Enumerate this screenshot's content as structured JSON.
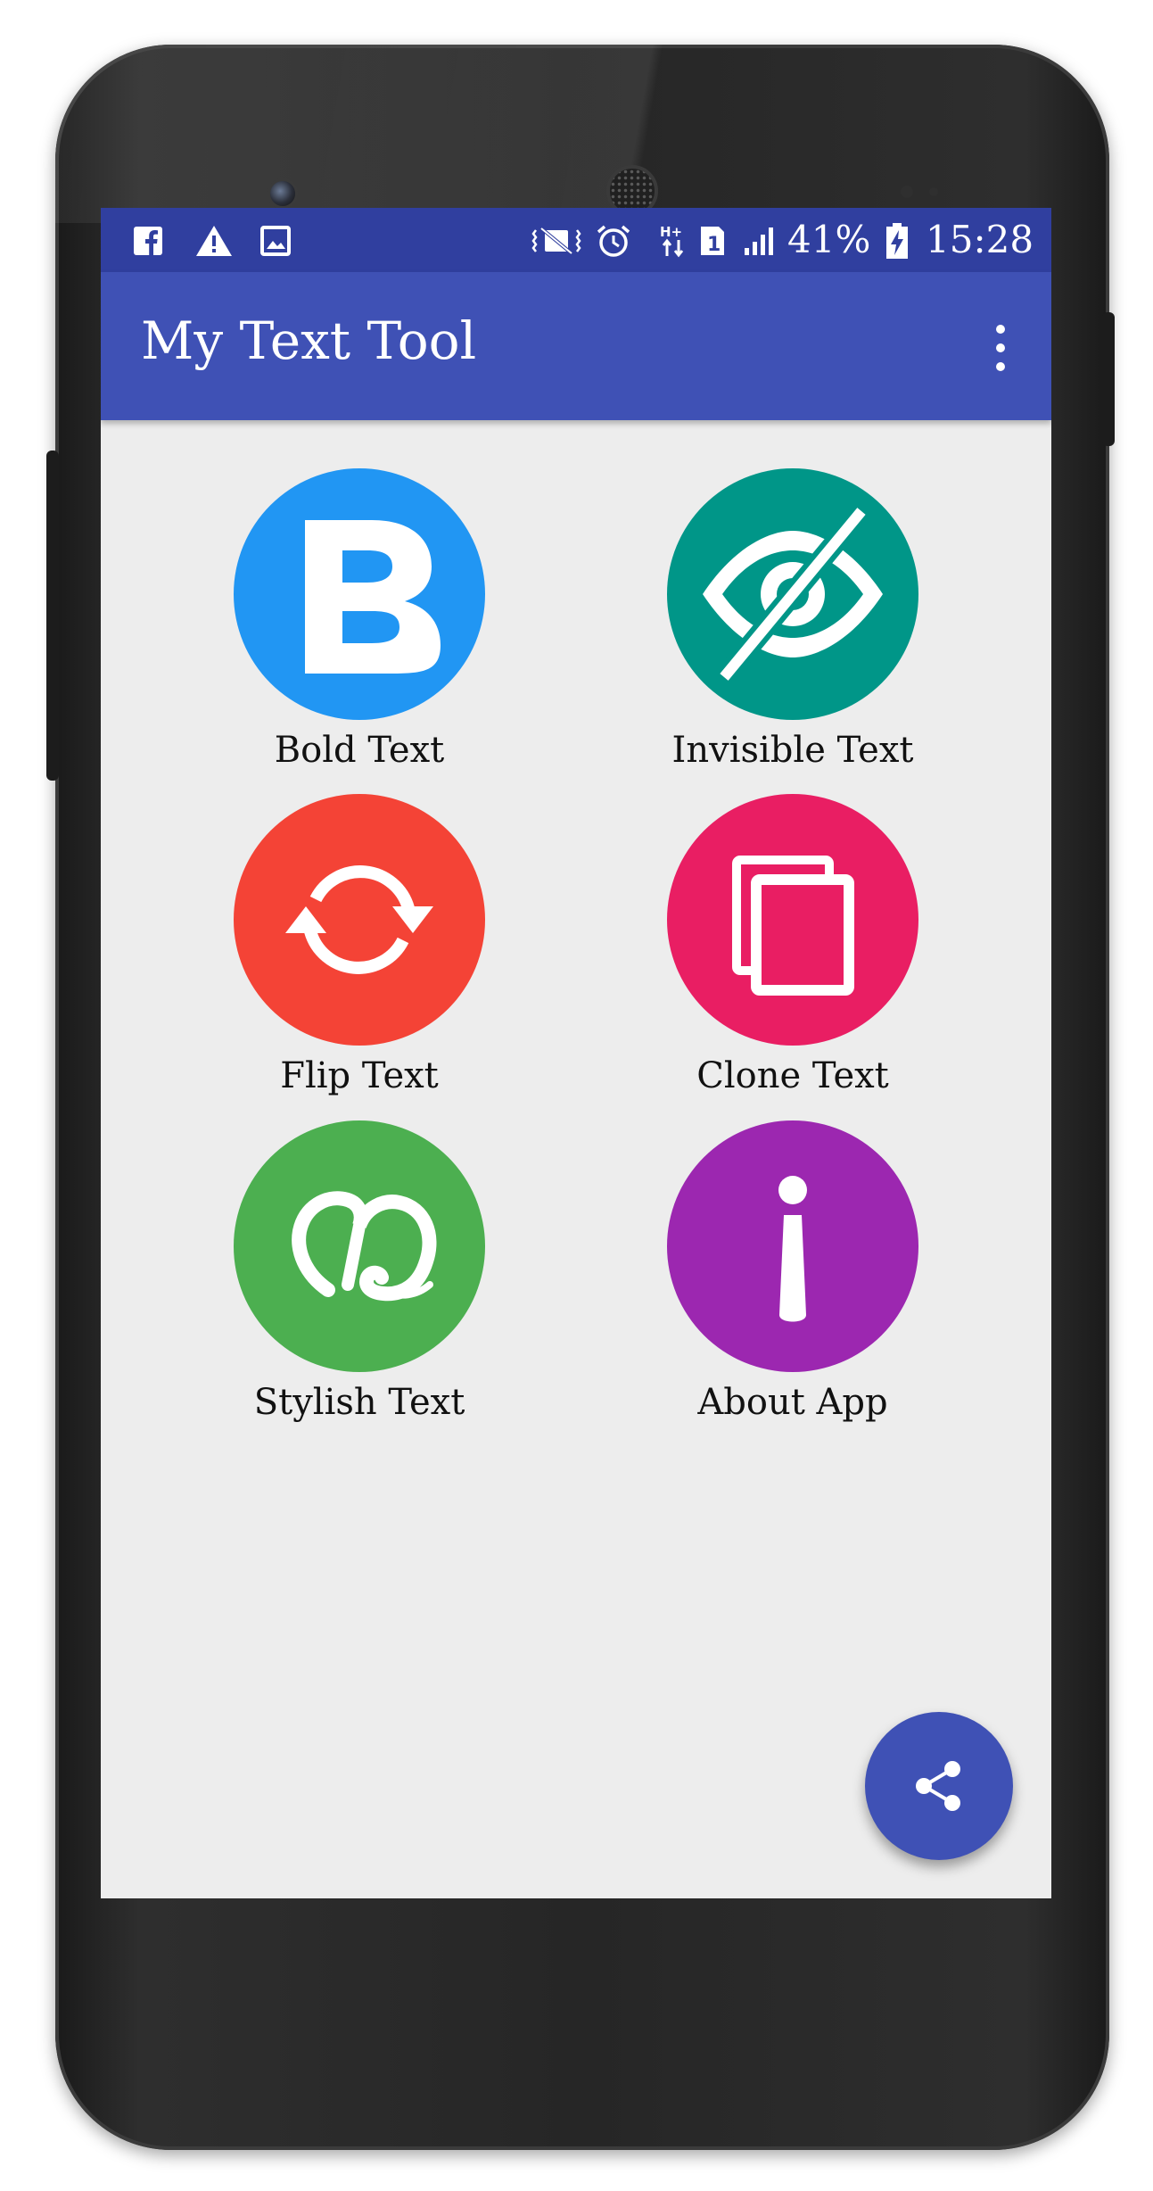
{
  "status_bar": {
    "notification_icons": [
      "facebook-icon",
      "warning-icon",
      "image-icon"
    ],
    "system_icons": [
      "vibrate-icon",
      "alarm-icon",
      "data-hplus-icon",
      "sim-1-icon",
      "signal-icon",
      "battery-charging-icon"
    ],
    "battery": "41%",
    "time": "15:28"
  },
  "app_bar": {
    "title": "My Text Tool",
    "menu_icon": "more-vert-icon"
  },
  "tiles": [
    {
      "label": "Bold Text",
      "icon": "bold-b-icon",
      "color": "#2196f3"
    },
    {
      "label": "Invisible Text",
      "icon": "eye-off-icon",
      "color": "#009688"
    },
    {
      "label": "Flip Text",
      "icon": "sync-arrows-icon",
      "color": "#f44336"
    },
    {
      "label": "Clone Text",
      "icon": "copy-pages-icon",
      "color": "#e91e63"
    },
    {
      "label": "Stylish Text",
      "icon": "stylish-glyph-icon",
      "color": "#4caf50"
    },
    {
      "label": "About App",
      "icon": "info-i-icon",
      "color": "#9c27b0"
    }
  ],
  "fab": {
    "icon": "share-icon",
    "color": "#3f51b5"
  },
  "colors": {
    "status_bar": "#303f9f",
    "app_bar": "#3f51b5",
    "background": "#ededed"
  }
}
